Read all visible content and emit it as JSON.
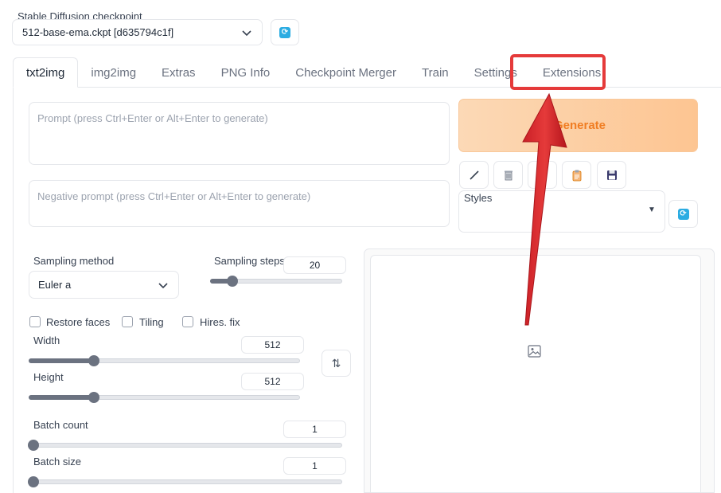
{
  "checkpoint": {
    "label": "Stable Diffusion checkpoint",
    "value": "512-base-ema.ckpt [d635794c1f]"
  },
  "tabs": [
    {
      "label": "txt2img",
      "active": true
    },
    {
      "label": "img2img"
    },
    {
      "label": "Extras"
    },
    {
      "label": "PNG Info"
    },
    {
      "label": "Checkpoint Merger"
    },
    {
      "label": "Train"
    },
    {
      "label": "Settings"
    },
    {
      "label": "Extensions",
      "highlighted": true
    }
  ],
  "prompt": {
    "placeholder": "Prompt (press Ctrl+Enter or Alt+Enter to generate)"
  },
  "negative_prompt": {
    "placeholder": "Negative prompt (press Ctrl+Enter or Alt+Enter to generate)"
  },
  "generate": {
    "label": "Generate"
  },
  "toolbar_icons": [
    "pencil-icon",
    "trash-icon",
    "red-square-icon",
    "clipboard-icon",
    "floppy-disk-icon"
  ],
  "styles": {
    "label": "Styles",
    "value": ""
  },
  "sampling_method": {
    "label": "Sampling method",
    "value": "Euler a"
  },
  "sampling_steps": {
    "label": "Sampling steps",
    "value": "20",
    "fraction": 0.17
  },
  "checkboxes": [
    {
      "label": "Restore faces",
      "checked": false
    },
    {
      "label": "Tiling",
      "checked": false
    },
    {
      "label": "Hires. fix",
      "checked": false
    }
  ],
  "width": {
    "label": "Width",
    "value": "512",
    "fraction": 0.24
  },
  "height": {
    "label": "Height",
    "value": "512",
    "fraction": 0.24
  },
  "batch_count": {
    "label": "Batch count",
    "value": "1",
    "fraction": 0.0
  },
  "batch_size": {
    "label": "Batch size",
    "value": "1",
    "fraction": 0.0
  },
  "colors": {
    "accent_refresh": "#2bace2",
    "generate_text": "#f07d22",
    "highlight": "#e53a3a"
  }
}
